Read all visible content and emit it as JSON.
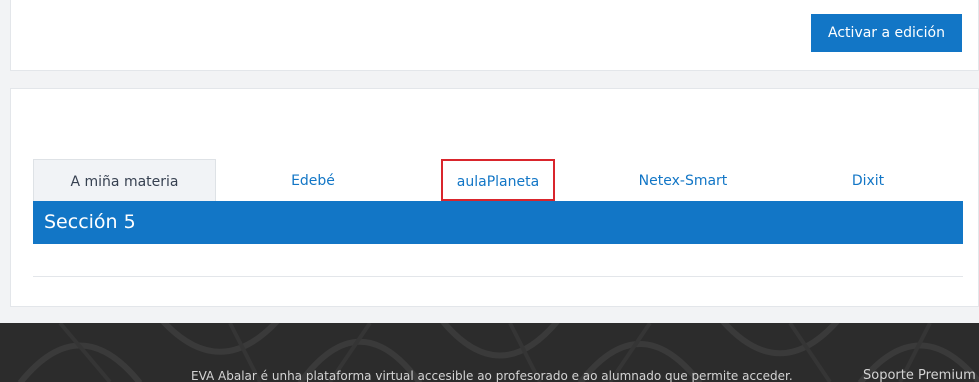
{
  "header": {
    "edit_button_label": "Activar a edición"
  },
  "course": {
    "tabs": [
      {
        "label": "A miña materia",
        "active": true
      },
      {
        "label": "Edebé",
        "active": false
      },
      {
        "label": "aulaPlaneta",
        "active": false,
        "highlighted": true
      },
      {
        "label": "Netex-Smart",
        "active": false
      },
      {
        "label": "Dixit",
        "active": false
      }
    ],
    "section_title": "Sección 5"
  },
  "footer": {
    "left_text": "",
    "description": "EVA Abalar é unha plataforma virtual accesible ao profesorado e ao alumnado que permite acceder.",
    "support_link": "Soporte Premium"
  },
  "colors": {
    "accent": "#1276c6",
    "highlight_border": "#d9252c",
    "footer_bg": "#2c2c2c"
  }
}
